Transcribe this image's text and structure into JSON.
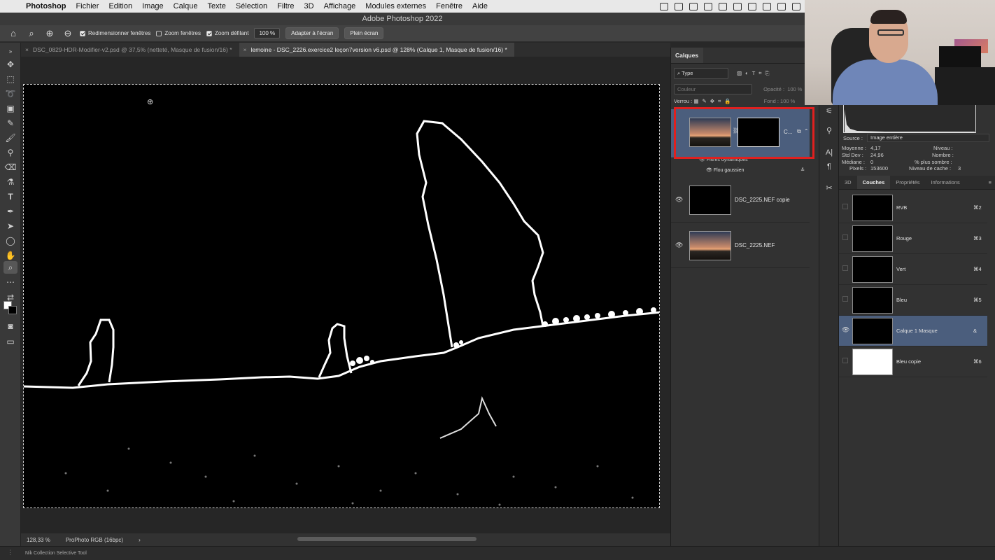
{
  "menubar": {
    "apple_icon": "apple-logo-icon",
    "items": [
      "Photoshop",
      "Fichier",
      "Edition",
      "Image",
      "Calque",
      "Texte",
      "Sélection",
      "Filtre",
      "3D",
      "Affichage",
      "Modules externes",
      "Fenêtre",
      "Aide"
    ]
  },
  "window": {
    "title": "Adobe Photoshop 2022"
  },
  "options": {
    "redim_label": "Redimensionner fenêtres",
    "zoom_fenetres_label": "Zoom fenêtres",
    "zoom_defilant_label": "Zoom défilant",
    "zoom_value": "100 %",
    "fit_button": "Adapter à l'écran",
    "fullscreen_button": "Plein écran"
  },
  "tabs": [
    {
      "label": "DSC_0829-HDR-Modifier-v2.psd @ 37,5% (netteté, Masque de fusion/16) *"
    },
    {
      "label": "lemoine - DSC_2226.exercice2 leçon7version v6.psd @ 128% (Calque 1, Masque de fusion/16) *"
    }
  ],
  "status": {
    "zoom": "128,33 %",
    "profile": "ProPhoto RGB (16bpc)",
    "arrow": "›"
  },
  "bottom": {
    "nik_label": "Nik Collection Selective Tool"
  },
  "layers": {
    "panel_title": "Calques",
    "filter_type": "Type",
    "blend_mode": "Couleur",
    "opacity_label": "Opacité :",
    "opacity_value": "100 %",
    "lock_label": "Verrou :",
    "fill_label": "Fond :",
    "fill_value": "100 %",
    "items": [
      {
        "name": "C...",
        "selected": true
      },
      {
        "name": "DSC_2225.NEF copie"
      },
      {
        "name": "DSC_2225.NEF"
      }
    ],
    "smart_filters_label": "Filtres dynamiques",
    "gaussian_blur_label": "Flou gaussien"
  },
  "histogram": {
    "source_label": "Source :",
    "source_value": "Image entière",
    "stats_left": [
      {
        "label": "Moyenne :",
        "value": "4,17"
      },
      {
        "label": "Std Dev :",
        "value": "24,96"
      },
      {
        "label": "Médiane :",
        "value": "0"
      },
      {
        "label": "Pixels :",
        "value": "153600"
      }
    ],
    "stats_right": [
      {
        "label": "Niveau :",
        "value": ""
      },
      {
        "label": "Nombre :",
        "value": ""
      },
      {
        "label": "% plus sombre :",
        "value": ""
      },
      {
        "label": "Niveau de cache :",
        "value": "3"
      }
    ]
  },
  "right_tabs": [
    "3D",
    "Couches",
    "Propriétés",
    "Informations"
  ],
  "channels": [
    {
      "name": "RVB",
      "key": "⌘2"
    },
    {
      "name": "Rouge",
      "key": "⌘3"
    },
    {
      "name": "Vert",
      "key": "⌘4"
    },
    {
      "name": "Bleu",
      "key": "⌘5"
    },
    {
      "name": "Calque 1 Masque",
      "key": "&",
      "selected": true
    },
    {
      "name": "Bleu copie",
      "key": "⌘6"
    }
  ],
  "colors": {
    "highlight_red": "#e0201f",
    "selection_blue": "#4b5e7d"
  }
}
